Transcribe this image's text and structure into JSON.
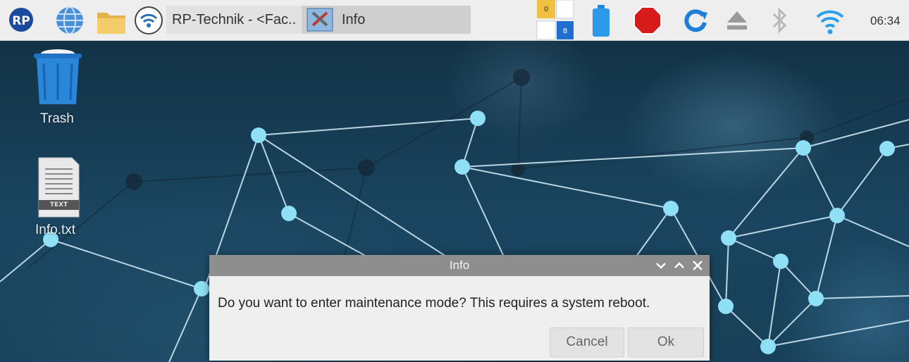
{
  "taskbar": {
    "window_1_title": "RP-Technik - <Fac..",
    "window_2_title": "Info",
    "clock": "06:34",
    "icons": [
      "rp-logo-icon",
      "web-browser-icon",
      "file-manager-icon",
      "wifi-config-icon",
      "notes-icon",
      "battery-icon",
      "stop-icon",
      "sync-icon",
      "eject-icon",
      "bluetooth-icon",
      "wifi-icon"
    ]
  },
  "desktop": {
    "icons": [
      {
        "label": "Trash",
        "icon": "trash-icon"
      },
      {
        "label": "Info.txt",
        "icon": "text-file-icon",
        "badge": "TEXT"
      }
    ]
  },
  "dialog": {
    "title": "Info",
    "message": "Do you want to enter maintenance mode? This requires a system reboot.",
    "buttons": {
      "cancel": "Cancel",
      "ok": "Ok"
    }
  },
  "colors": {
    "taskbar_bg": "#eeeeee",
    "dialog_titlebar": "#8e8e8e",
    "network_node": "#8fe0f5",
    "desktop_bg": "#173e55"
  }
}
